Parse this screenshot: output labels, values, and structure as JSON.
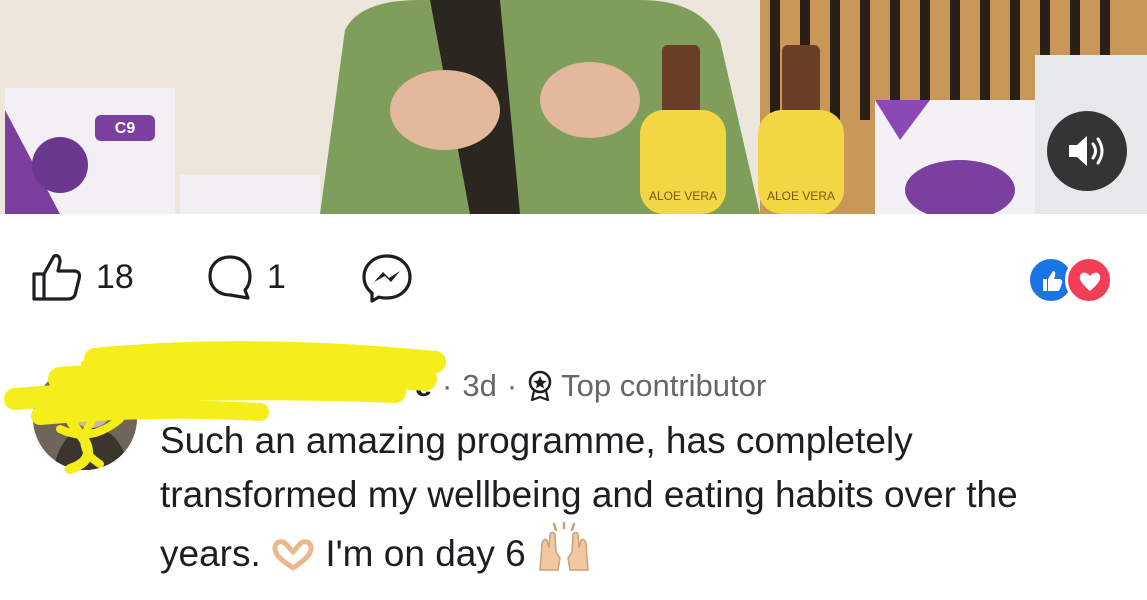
{
  "post": {
    "video": {
      "product_labels": [
        "ALOE VERA",
        "ALOE VERA"
      ],
      "kit_label": "C9",
      "icons": {
        "mute": "speaker-volume-icon"
      }
    },
    "stats": {
      "like_count": "18",
      "comment_count": "1"
    },
    "icons": {
      "like": "thumbs-up-icon",
      "comment": "comment-bubble-icon",
      "share": "messenger-icon",
      "reactions": [
        "like-reaction-icon",
        "love-reaction-icon"
      ]
    },
    "colors": {
      "like_blue": "#1b74e4",
      "love_red": "#f33e58",
      "text": "#1c1e21",
      "meta": "#65676b",
      "highlighter": "#f5ee1a"
    }
  },
  "comment": {
    "author_tail": "e",
    "time": "3d",
    "separator": "·",
    "badge": "Top contributor",
    "text_main": "Such an amazing programme, has completely transformed my wellbeing and eating habits over the years.",
    "text_tail": "I'm on day 6",
    "emojis": [
      "heart-hands-emoji",
      "raised-hands-emoji"
    ]
  }
}
